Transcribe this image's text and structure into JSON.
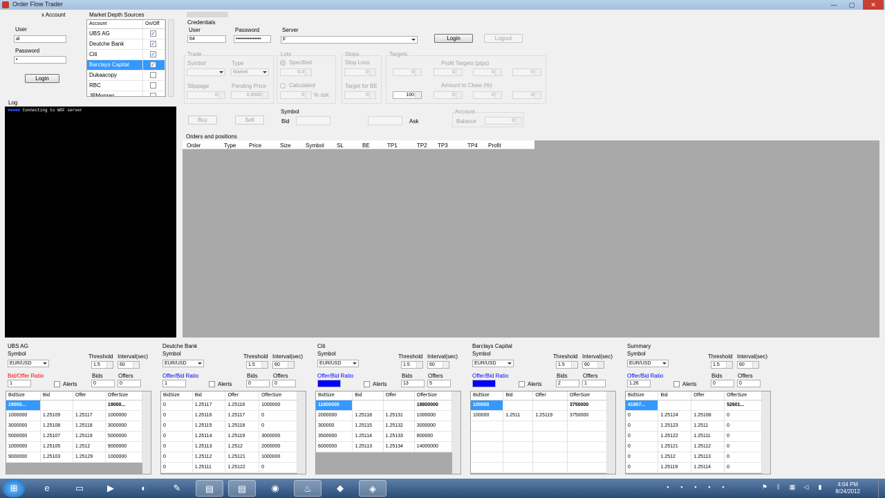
{
  "window": {
    "title": "Order Flow Trader",
    "min": "—",
    "max": "▢",
    "close": "✕"
  },
  "account": {
    "label": "x Account",
    "user_label": "User",
    "user_value": "al",
    "password_label": "Password",
    "password_value": "•",
    "login": "Login"
  },
  "sources": {
    "label": "Market Depth Sources",
    "col_account": "Account",
    "col_onoff": "On/Off",
    "rows": [
      {
        "name": "UBS AG",
        "on": "✓"
      },
      {
        "name": "Deutche Bank",
        "on": "✓"
      },
      {
        "name": "Citi",
        "on": "✓"
      },
      {
        "name": "Barclays Capital",
        "on": "✓"
      },
      {
        "name": "Dukaacopy",
        "on": ""
      },
      {
        "name": "RBC",
        "on": ""
      },
      {
        "name": "JPMorgan",
        "on": ""
      }
    ]
  },
  "log": {
    "label": "Log",
    "line": "Connecting to WOF server"
  },
  "credentials": {
    "label": "Credentials",
    "user_label": "User",
    "user_value": "64",
    "password_label": "Password",
    "password_value": "•••••••••••••••",
    "server_label": "Server",
    "server_value": "F",
    "login": "Login",
    "logout": "Logout"
  },
  "trade": {
    "label": "Trade",
    "symbol": "Symbol",
    "type": "Type",
    "type_value": "Market",
    "slippage": "Slippage",
    "slippage_value": "0",
    "pending": "Pending Price",
    "pending_value": "0.0000"
  },
  "lots": {
    "label": "Lots",
    "specified": "Specified",
    "specified_value": "0.0",
    "calculated": "Calculated",
    "calculated_value": "0",
    "risk": "% risk"
  },
  "stops": {
    "label": "Stops",
    "stoploss": "Stop Loss",
    "stoploss_value": "0",
    "be": "Target for BE",
    "be_value": "0"
  },
  "targets": {
    "label": "Targets",
    "profit": "Profit Targets (pips)",
    "amount": "Amount to Close (%)",
    "v1": "0",
    "v2": "0",
    "v3": "0",
    "v4": "0",
    "a1": "100",
    "a2": "0",
    "a3": "0",
    "a4": "0"
  },
  "actions": {
    "buy": "Buy",
    "sell": "Sell",
    "symbol": "Symbol",
    "bid": "Bid",
    "ask": "Ask"
  },
  "acct": {
    "label": "Account",
    "balance": "Balance",
    "balance_value": "0"
  },
  "orders": {
    "label": "Orders and positions",
    "cols": [
      "Order",
      "Type",
      "Price",
      "Size",
      "Symbol",
      "SL",
      "BE",
      "TP1",
      "TP2",
      "TP3",
      "TP4",
      "Profit"
    ]
  },
  "panels": [
    {
      "name": "UBS AG",
      "symbol_label": "Symbol",
      "symbol": "EUR/USD",
      "threshold": "Threshold",
      "threshold_value": "1.5",
      "interval": "Interval(sec)",
      "interval_value": "60",
      "ratio_label": "Bid/Offer Ratio",
      "ratio_value": "1",
      "alerts": "Alerts",
      "bids": "Bids",
      "bids_value": "0",
      "offers": "Offers",
      "offers_value": "0",
      "cols": [
        "BidSize",
        "Bid",
        "Offer",
        "OfferSize"
      ],
      "rows": [
        [
          "19000...",
          "",
          "",
          "19000..."
        ],
        [
          "1000000",
          "1.25109",
          "1.25117",
          "1000000"
        ],
        [
          "3000000",
          "1.25108",
          "1.25118",
          "3000000"
        ],
        [
          "5000000",
          "1.25107",
          "1.25119",
          "5000000"
        ],
        [
          "1000000",
          "1.25105",
          "1.2512",
          "9000000"
        ],
        [
          "9000000",
          "1.25103",
          "1.25129",
          "1000000"
        ]
      ]
    },
    {
      "name": "Deutche Bank",
      "symbol_label": "Symbol",
      "symbol": "EUR/USD",
      "threshold": "Threshold",
      "threshold_value": "1.5",
      "interval": "Interval(sec)",
      "interval_value": "60",
      "ratio_label": "Offer/Bid Ratio",
      "ratio_value": "1",
      "alerts": "Alerts",
      "bids": "Bids",
      "bids_value": "0",
      "offers": "Offers",
      "offers_value": "0",
      "cols": [
        "BidSize",
        "Bid",
        "Offer",
        "OfferSize"
      ],
      "rows": [
        [
          "0",
          "1.25117",
          "1.25116",
          "1000000"
        ],
        [
          "0",
          "1.25116",
          "1.25117",
          "0"
        ],
        [
          "0",
          "1.25115",
          "1.25118",
          "0"
        ],
        [
          "0",
          "1.25114",
          "1.25119",
          "3000000"
        ],
        [
          "0",
          "1.25113",
          "1.2512",
          "2000000"
        ],
        [
          "0",
          "1.25112",
          "1.25121",
          "1000000"
        ],
        [
          "0",
          "1.25111",
          "1.25122",
          "0"
        ]
      ]
    },
    {
      "name": "Citi",
      "symbol_label": "Symbol",
      "symbol": "EUR/USD",
      "threshold": "Threshold",
      "threshold_value": "1.5",
      "interval": "Interval(sec)",
      "interval_value": "60",
      "ratio_label": "Offer/Bid Ratio",
      "ratio_value": "",
      "alerts": "Alerts",
      "bids": "Bids",
      "bids_value": "13",
      "offers": "Offers",
      "offers_value": "5",
      "cols": [
        "BidSize",
        "Bid",
        "Offer",
        "OfferSize"
      ],
      "rows": [
        [
          "11800000",
          "",
          "",
          "18800000"
        ],
        [
          "2000000",
          "1.25118",
          "1.25131",
          "1000000"
        ],
        [
          "300000",
          "1.25115",
          "1.25132",
          "3000000"
        ],
        [
          "3500000",
          "1.25114",
          "1.25133",
          "800000"
        ],
        [
          "6000000",
          "1.25113",
          "1.25134",
          "14000000"
        ]
      ]
    },
    {
      "name": "Barclays Capital",
      "symbol_label": "Symbol",
      "symbol": "EUR/USD",
      "threshold": "Threshold",
      "threshold_value": "1.5",
      "interval": "Interval(sec)",
      "interval_value": "60",
      "ratio_label": "Offer/Bid Ratio",
      "ratio_value": "",
      "alerts": "Alerts",
      "bids": "Bids",
      "bids_value": "2",
      "offers": "Offers",
      "offers_value": "1",
      "cols": [
        "BidSize",
        "Bid",
        "Offer",
        "OfferSize"
      ],
      "rows": [
        [
          "100000",
          "",
          "",
          "3750000"
        ],
        [
          "100000",
          "1.2511",
          "1.25119",
          "3750000"
        ],
        [
          "",
          "",
          "",
          ""
        ],
        [
          "",
          "",
          "",
          ""
        ],
        [
          "",
          "",
          "",
          ""
        ],
        [
          "",
          "",
          "",
          ""
        ],
        [
          "",
          "",
          "",
          ""
        ]
      ]
    },
    {
      "name": "Summary",
      "symbol_label": "Symbol",
      "symbol": "EUR/USD",
      "threshold": "Threshold",
      "threshold_value": "1.5",
      "interval": "Interval(sec)",
      "interval_value": "60",
      "ratio_label": "Offer/Bid Ratio",
      "ratio_value": "1.26",
      "alerts": "Alerts",
      "bids": "Bids",
      "bids_value": "0",
      "offers": "Offers",
      "offers_value": "0",
      "cols": [
        "BidSize",
        "Bid",
        "Offer",
        "OfferSize"
      ],
      "rows": [
        [
          "41907...",
          "",
          "",
          "52601..."
        ],
        [
          "0",
          "1.25124",
          "1.25108",
          "0"
        ],
        [
          "0",
          "1.25123",
          "1.2511",
          "0"
        ],
        [
          "0",
          "1.25122",
          "1.25111",
          "0"
        ],
        [
          "0",
          "1.25121",
          "1.25112",
          "0"
        ],
        [
          "0",
          "1.2512",
          "1.25113",
          "0"
        ],
        [
          "0",
          "1.25119",
          "1.25114",
          "0"
        ]
      ]
    }
  ],
  "taskbar": {
    "time": "4:04 PM",
    "date": "8/24/2012"
  },
  "colors": {
    "selection": "#3399ff",
    "ratio_blue": "#0000ff",
    "ratio_red": "#ff0000"
  }
}
